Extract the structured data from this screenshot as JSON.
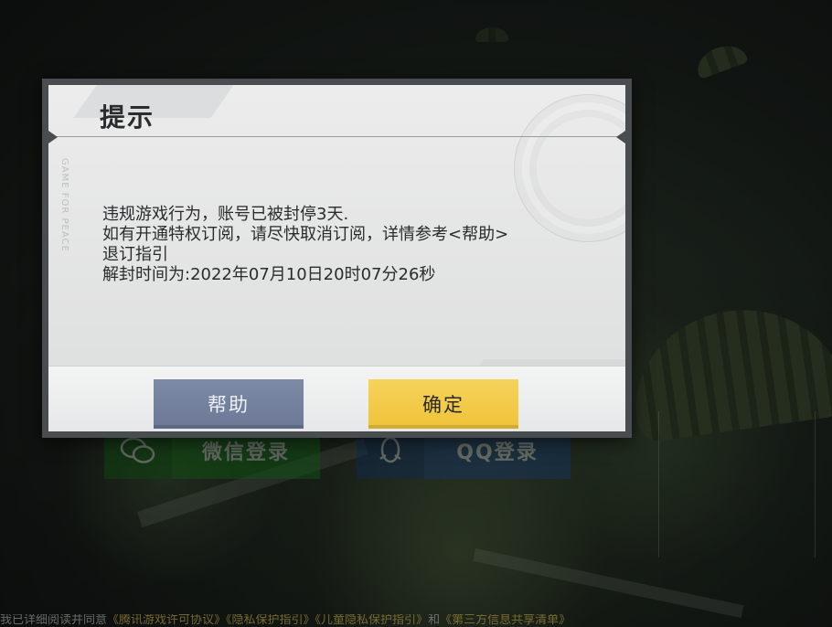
{
  "background": {
    "wechat_login_label": "微信登录",
    "qq_login_label": "QQ登录",
    "footer": {
      "prefix": "我已详细阅读并同意",
      "link_1": "《腾讯游戏许可协议》",
      "link_2": "《隐私保护指引》",
      "link_3": "《儿童隐私保护指引》",
      "connector": "和",
      "link_4": "《第三方信息共享清单》"
    }
  },
  "dialog": {
    "title": "提示",
    "vertical_text": "GAME FOR PEACE",
    "message_lines": [
      "违规游戏行为，账号已被封停3天.",
      "如有开通特权订阅，请尽快取消订阅，详情参考<帮助>",
      "退订指引",
      "解封时间为:2022年07月10日20时07分26秒"
    ],
    "help_button_label": "帮助",
    "confirm_button_label": "确定"
  },
  "colors": {
    "help_button": "#7482a0",
    "confirm_button": "#f2c94c",
    "dialog_border": "#4a4d50",
    "dialog_bg": "#e6e7e7"
  }
}
